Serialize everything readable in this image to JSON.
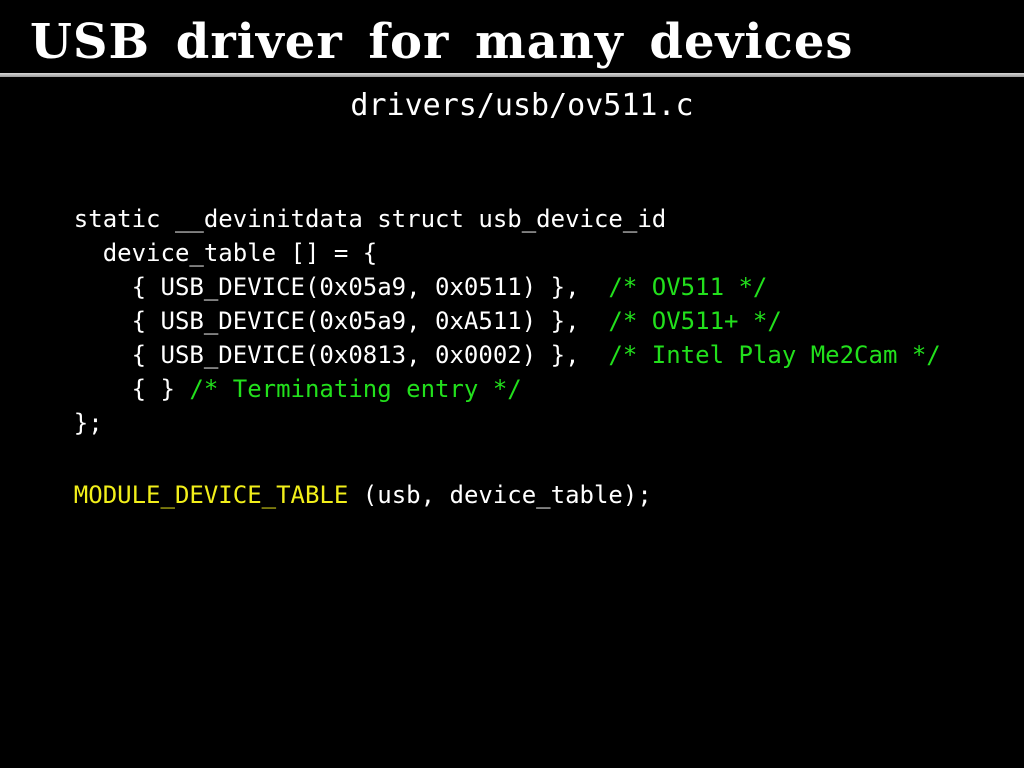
{
  "slide": {
    "title": "USB driver for many devices",
    "file_path": "drivers/usb/ov511.c"
  },
  "code": {
    "line1": "static __devinitdata struct usb_device_id",
    "line2": "  device_table [] = {",
    "line3_code": "    { USB_DEVICE(0x05a9, 0x0511) },  ",
    "line3_comment": "/* OV511 */",
    "line4_code": "    { USB_DEVICE(0x05a9, 0xA511) },  ",
    "line4_comment": "/* OV511+ */",
    "line5_code": "    { USB_DEVICE(0x0813, 0x0002) },  ",
    "line5_comment": "/* Intel Play Me2Cam */",
    "line6_code": "    { } ",
    "line6_comment": "/* Terminating entry */",
    "line7": "};",
    "macro_name": "MODULE_DEVICE_TABLE",
    "macro_args": " (usb, device_table);"
  },
  "colors": {
    "background": "#000000",
    "text": "#ffffff",
    "comment": "#22e01c",
    "macro": "#f2ef1a"
  }
}
